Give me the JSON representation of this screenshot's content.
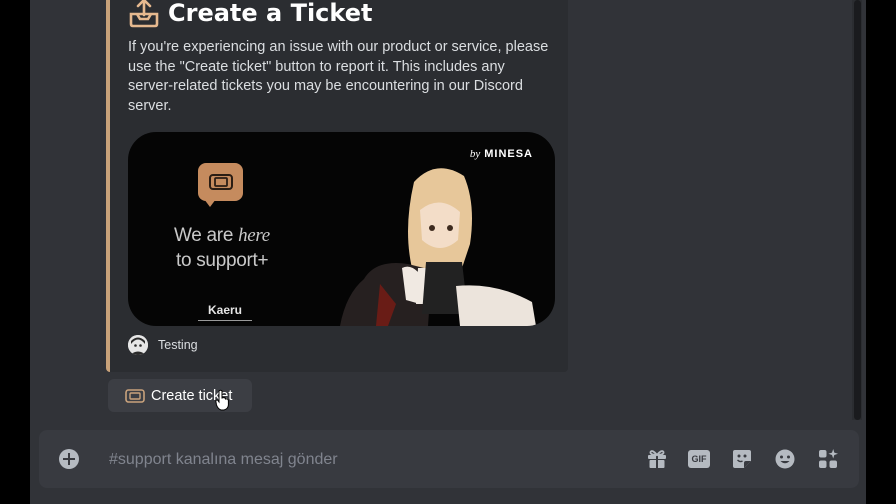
{
  "embed": {
    "title": "Create a Ticket",
    "description": "If you're experiencing an issue with our product or service, please use the \"Create ticket\" button to report it. This includes any server-related tickets you may be encountering in our Discord server.",
    "image": {
      "brand_by": "by",
      "brand_name": "MINESA",
      "slogan_we_are": "We are ",
      "slogan_here": "here",
      "slogan_to": "to ",
      "slogan_support": "support+",
      "logo_text": "Kaeru"
    },
    "footer_text": "Testing",
    "accent_color": "#c8a27a"
  },
  "create_button": {
    "label": "Create ticket",
    "icon": "ticket-icon"
  },
  "composer": {
    "placeholder": "#support kanalına mesaj gönder",
    "value": "",
    "tools": [
      "gift-icon",
      "gif-icon",
      "sticker-icon",
      "emoji-icon",
      "apps-icon"
    ],
    "gif_label": "GIF"
  }
}
